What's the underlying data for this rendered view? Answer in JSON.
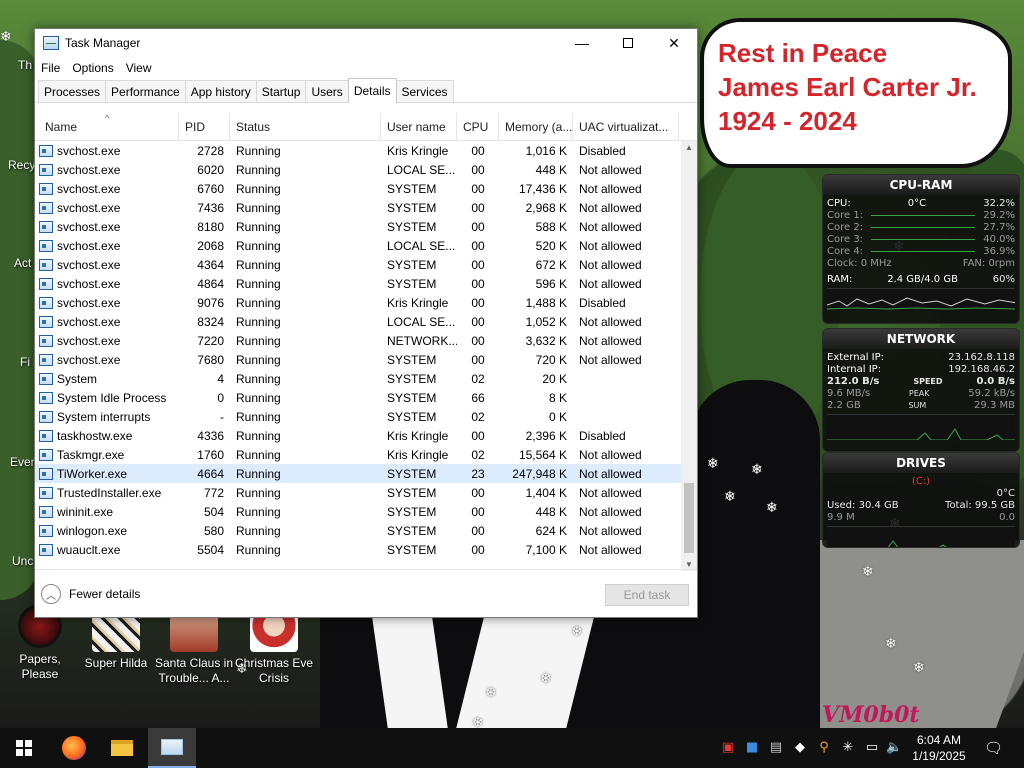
{
  "desktop": {
    "bubble_lines": [
      "Rest in Peace",
      "James Earl Carter Jr.",
      "1924 - 2024"
    ],
    "icons": [
      {
        "label": "Papers, Please"
      },
      {
        "label": "Super Hilda"
      },
      {
        "label": "Santa Claus in Trouble... A..."
      },
      {
        "label": "Christmas Eve Crisis"
      }
    ],
    "edge_labels": [
      "Th",
      "Recy",
      "Act",
      "Fi",
      "Ever",
      "Unc"
    ],
    "watermark": "VM0b0t"
  },
  "taskmgr": {
    "title": "Task Manager",
    "menu": [
      "File",
      "Options",
      "View"
    ],
    "tabs": [
      "Processes",
      "Performance",
      "App history",
      "Startup",
      "Users",
      "Details",
      "Services"
    ],
    "active_tab": "Details",
    "columns": [
      "Name",
      "PID",
      "Status",
      "User name",
      "CPU",
      "Memory (a...",
      "UAC virtualizat..."
    ],
    "rows": [
      {
        "name": "svchost.exe",
        "pid": "2728",
        "status": "Running",
        "user": "Kris Kringle",
        "cpu": "00",
        "mem": "1,016 K",
        "uac": "Disabled"
      },
      {
        "name": "svchost.exe",
        "pid": "6020",
        "status": "Running",
        "user": "LOCAL SE...",
        "cpu": "00",
        "mem": "448 K",
        "uac": "Not allowed"
      },
      {
        "name": "svchost.exe",
        "pid": "6760",
        "status": "Running",
        "user": "SYSTEM",
        "cpu": "00",
        "mem": "17,436 K",
        "uac": "Not allowed"
      },
      {
        "name": "svchost.exe",
        "pid": "7436",
        "status": "Running",
        "user": "SYSTEM",
        "cpu": "00",
        "mem": "2,968 K",
        "uac": "Not allowed"
      },
      {
        "name": "svchost.exe",
        "pid": "8180",
        "status": "Running",
        "user": "SYSTEM",
        "cpu": "00",
        "mem": "588 K",
        "uac": "Not allowed"
      },
      {
        "name": "svchost.exe",
        "pid": "2068",
        "status": "Running",
        "user": "LOCAL SE...",
        "cpu": "00",
        "mem": "520 K",
        "uac": "Not allowed"
      },
      {
        "name": "svchost.exe",
        "pid": "4364",
        "status": "Running",
        "user": "SYSTEM",
        "cpu": "00",
        "mem": "672 K",
        "uac": "Not allowed"
      },
      {
        "name": "svchost.exe",
        "pid": "4864",
        "status": "Running",
        "user": "SYSTEM",
        "cpu": "00",
        "mem": "596 K",
        "uac": "Not allowed"
      },
      {
        "name": "svchost.exe",
        "pid": "9076",
        "status": "Running",
        "user": "Kris Kringle",
        "cpu": "00",
        "mem": "1,488 K",
        "uac": "Disabled"
      },
      {
        "name": "svchost.exe",
        "pid": "8324",
        "status": "Running",
        "user": "LOCAL SE...",
        "cpu": "00",
        "mem": "1,052 K",
        "uac": "Not allowed"
      },
      {
        "name": "svchost.exe",
        "pid": "7220",
        "status": "Running",
        "user": "NETWORK...",
        "cpu": "00",
        "mem": "3,632 K",
        "uac": "Not allowed"
      },
      {
        "name": "svchost.exe",
        "pid": "7680",
        "status": "Running",
        "user": "SYSTEM",
        "cpu": "00",
        "mem": "720 K",
        "uac": "Not allowed"
      },
      {
        "name": "System",
        "pid": "4",
        "status": "Running",
        "user": "SYSTEM",
        "cpu": "02",
        "mem": "20 K",
        "uac": ""
      },
      {
        "name": "System Idle Process",
        "pid": "0",
        "status": "Running",
        "user": "SYSTEM",
        "cpu": "66",
        "mem": "8 K",
        "uac": ""
      },
      {
        "name": "System interrupts",
        "pid": "-",
        "status": "Running",
        "user": "SYSTEM",
        "cpu": "02",
        "mem": "0 K",
        "uac": ""
      },
      {
        "name": "taskhostw.exe",
        "pid": "4336",
        "status": "Running",
        "user": "Kris Kringle",
        "cpu": "00",
        "mem": "2,396 K",
        "uac": "Disabled"
      },
      {
        "name": "Taskmgr.exe",
        "pid": "1760",
        "status": "Running",
        "user": "Kris Kringle",
        "cpu": "02",
        "mem": "15,564 K",
        "uac": "Not allowed"
      },
      {
        "name": "TiWorker.exe",
        "pid": "4664",
        "status": "Running",
        "user": "SYSTEM",
        "cpu": "23",
        "mem": "247,948 K",
        "uac": "Not allowed",
        "selected": true
      },
      {
        "name": "TrustedInstaller.exe",
        "pid": "772",
        "status": "Running",
        "user": "SYSTEM",
        "cpu": "00",
        "mem": "1,404 K",
        "uac": "Not allowed"
      },
      {
        "name": "wininit.exe",
        "pid": "504",
        "status": "Running",
        "user": "SYSTEM",
        "cpu": "00",
        "mem": "448 K",
        "uac": "Not allowed"
      },
      {
        "name": "winlogon.exe",
        "pid": "580",
        "status": "Running",
        "user": "SYSTEM",
        "cpu": "00",
        "mem": "624 K",
        "uac": "Not allowed"
      },
      {
        "name": "wuauclt.exe",
        "pid": "5504",
        "status": "Running",
        "user": "SYSTEM",
        "cpu": "00",
        "mem": "7,100 K",
        "uac": "Not allowed"
      }
    ],
    "fewer_details": "Fewer details",
    "end_task": "End task"
  },
  "cpu_widget": {
    "title": "CPU-RAM",
    "cpu_label": "CPU:",
    "cpu_temp": "0°C",
    "cpu_pct": "32.2%",
    "cores": [
      {
        "label": "Core 1:",
        "val": "29.2%"
      },
      {
        "label": "Core 2:",
        "val": "27.7%"
      },
      {
        "label": "Core 3:",
        "val": "40.0%"
      },
      {
        "label": "Core 4:",
        "val": "36.9%"
      }
    ],
    "clock": "Clock: 0 MHz",
    "fan": "FAN: 0rpm",
    "ram_label": "RAM:",
    "ram_used": "2.4 GB/4.0 GB",
    "ram_pct": "60%"
  },
  "net_widget": {
    "title": "NETWORK",
    "ext_label": "External IP:",
    "ext_ip": "23.162.8.118",
    "int_label": "Internal IP:",
    "int_ip": "192.168.46.2",
    "speed_l": "212.0 B/s",
    "speed_tag": "SPEED",
    "speed_r": "0.0 B/s",
    "peak_l": "9.6 MB/s",
    "peak_tag": "PEAK",
    "peak_r": "59.2 kB/s",
    "sum_l": "2.2 GB",
    "sum_tag": "SUM",
    "sum_r": "29.3 MB"
  },
  "drives_widget": {
    "title": "DRIVES",
    "drive": "(C:)",
    "temp": "0°C",
    "used": "Used: 30.4 GB",
    "total": "Total: 99.5 GB",
    "read": "9.9 M",
    "write": "0.0"
  },
  "taskbar": {
    "time": "6:04 AM",
    "date": "1/19/2025"
  }
}
